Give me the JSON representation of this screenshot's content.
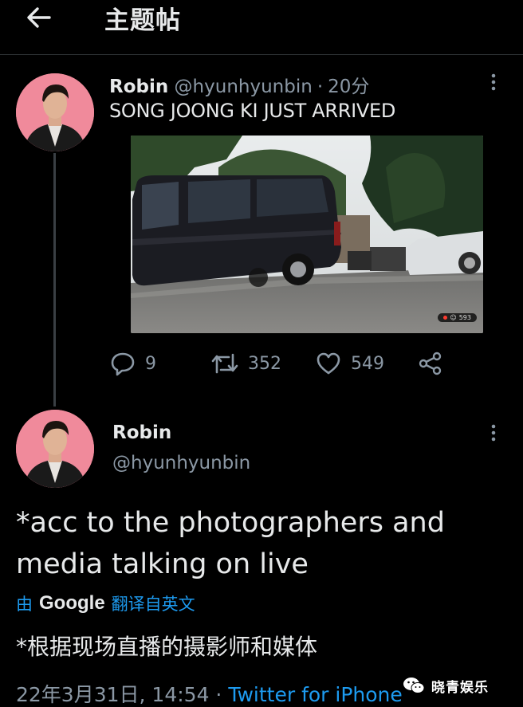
{
  "header": {
    "title": "主题帖"
  },
  "parent_tweet": {
    "name": "Robin",
    "handle": "@hyunhyunbin",
    "separator": "·",
    "time": "20分",
    "text": "SONG JOONG KI JUST ARRIVED",
    "photo_badge": "593",
    "actions": {
      "reply_count": "9",
      "retweet_count": "352",
      "like_count": "549"
    }
  },
  "main_tweet": {
    "name": "Robin",
    "handle": "@hyunhyunbin",
    "text": "*acc to the photographers and media talking on live",
    "translate_by": "由",
    "translate_provider": "Google",
    "translate_from": "翻译自英文",
    "translated_text": "*根据现场直播的摄影师和媒体",
    "timestamp": "22年3月31日, 14:54",
    "separator": "·",
    "source": "Twitter for iPhone"
  },
  "watermark": {
    "label": "晓青娱乐"
  },
  "colors": {
    "background": "#000000",
    "accent": "#1d9bf0",
    "secondary_text": "#8b98a5",
    "avatar_bg": "#f08a9b"
  },
  "icons": {
    "back": "arrow-left-icon",
    "more": "more-vertical-icon",
    "reply": "speech-bubble-icon",
    "retweet": "retweet-icon",
    "like": "heart-icon",
    "share": "share-icon"
  }
}
